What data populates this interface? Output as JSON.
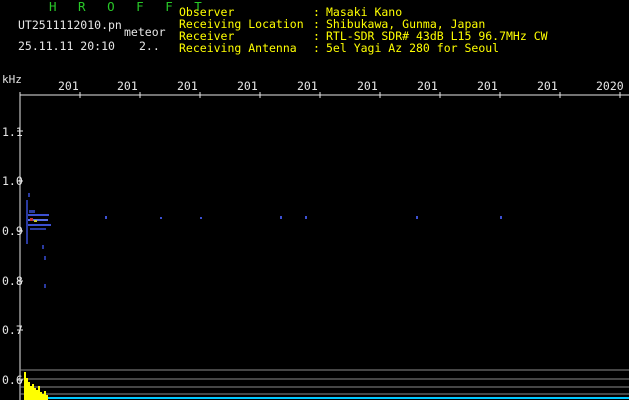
{
  "header": {
    "title": "H R O F F T",
    "filename": "UT2511112010.pn",
    "mode": "meteor",
    "datetime": "25.11.11 20:10",
    "count": "2..",
    "info": [
      {
        "label": "Observer",
        "value": "Masaki Kano"
      },
      {
        "label": "Receiving Location",
        "value": "Shibukawa, Gunma, Japan"
      },
      {
        "label": "Receiver",
        "value": "RTL-SDR SDR# 43dB L15 96.7MHz CW"
      },
      {
        "label": "Receiving Antenna",
        "value": "5el Yagi Az 280 for Seoul"
      }
    ],
    "colon": ":"
  },
  "axis": {
    "y_unit": "kHz",
    "y_ticks": [
      "1.1",
      "1.0",
      "0.9",
      "0.8",
      "0.7",
      "0.6"
    ],
    "x_ticks": [
      "201",
      "201",
      "201",
      "201",
      "201",
      "201",
      "201",
      "201",
      "201",
      "2020"
    ]
  },
  "colors": {
    "text_primary": "#ffff00",
    "title": "#28c828",
    "axis_text": "#e6e6e6",
    "signal": "#3c50d2",
    "bar": "#ffff00",
    "baseline": "#00c8ff"
  }
}
